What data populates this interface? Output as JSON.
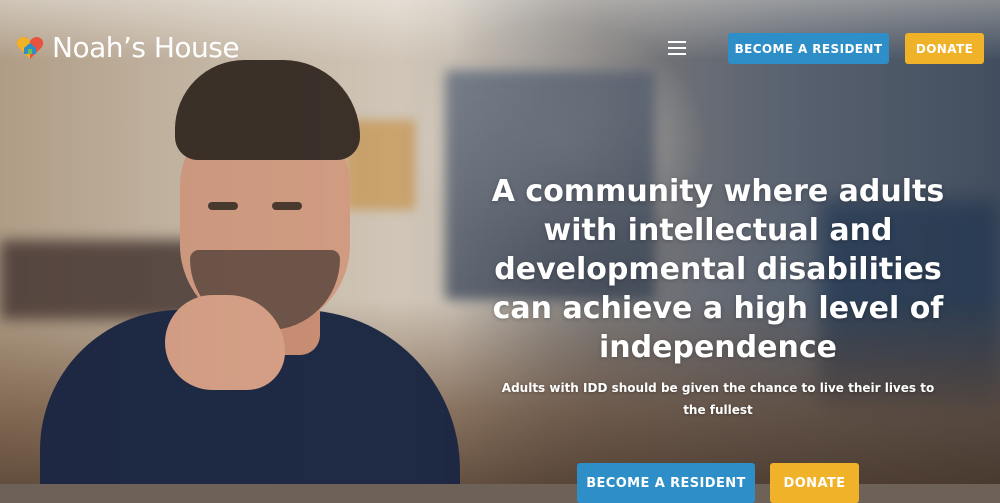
{
  "header": {
    "logo_text": "Noah’s House",
    "logo_icon": "heart-house-icon",
    "menu_icon": "hamburger-menu-icon",
    "nav_buttons": {
      "become_resident": "BECOME A RESIDENT",
      "donate": "DONATE"
    }
  },
  "hero": {
    "headline": "A community where adults with intellectual and developmental disabilities can achieve a high level of independence",
    "subheadline": "Adults with IDD should be given the chance to live their lives to the fullest",
    "cta_buttons": {
      "become_resident": "BECOME A RESIDENT",
      "donate": "DONATE"
    }
  },
  "colors": {
    "primary_blue": "#2e8ec7",
    "accent_gold": "#f0b229",
    "text_white": "#ffffff"
  }
}
